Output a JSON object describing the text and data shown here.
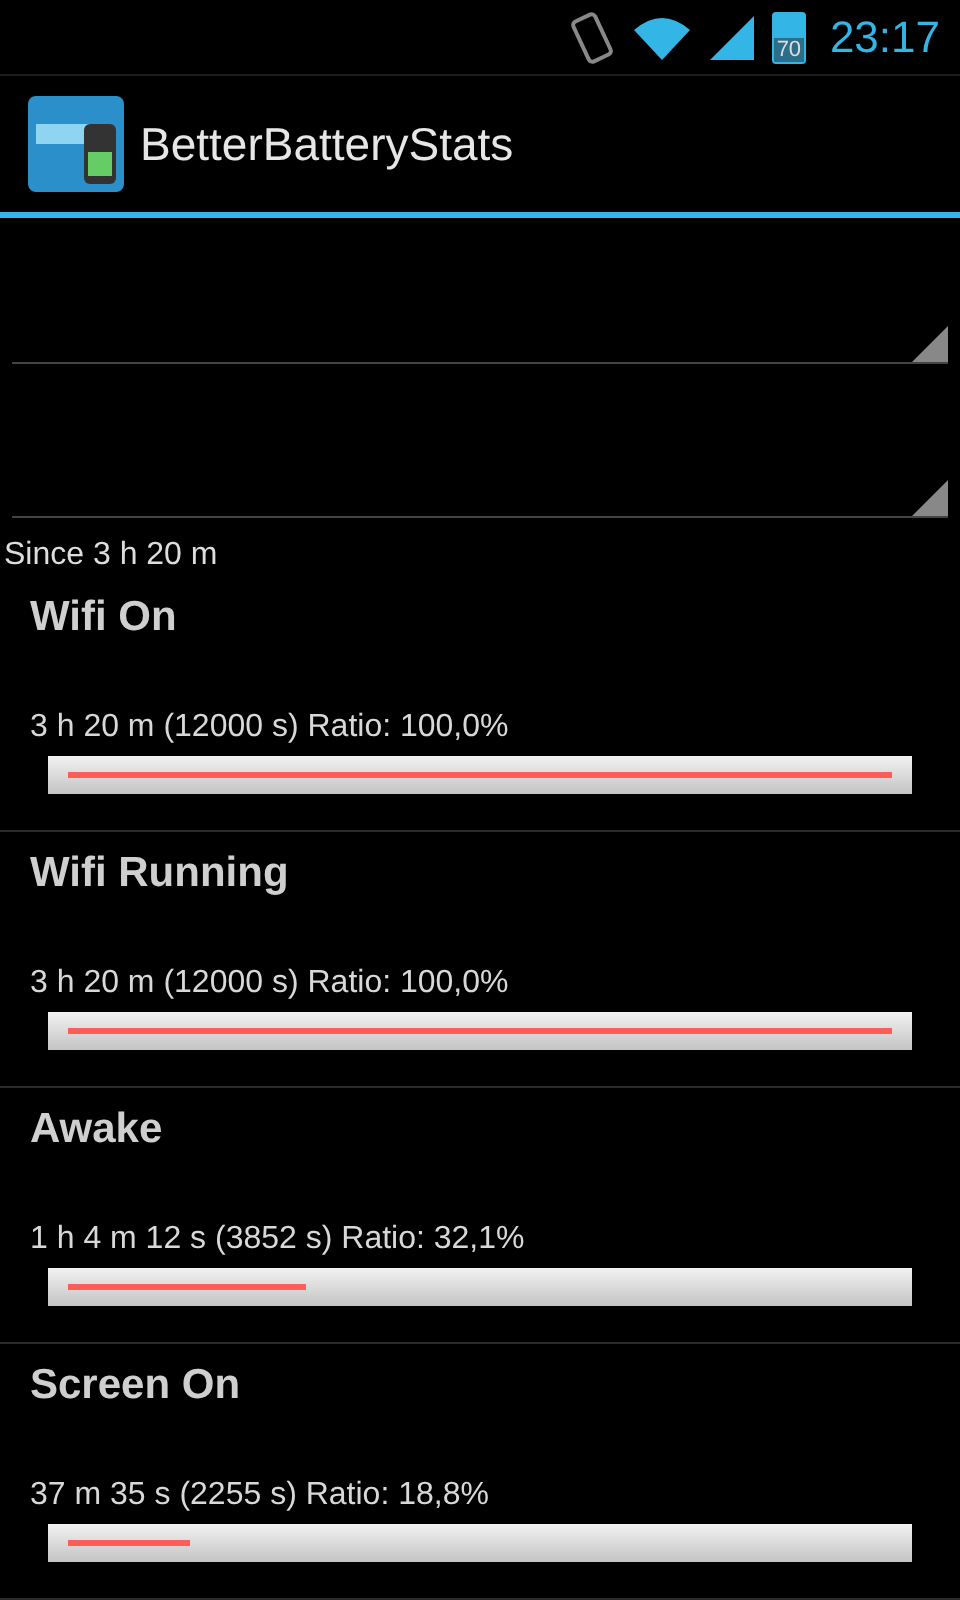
{
  "status_bar": {
    "battery": "70",
    "time": "23:17"
  },
  "action_bar": {
    "title": "BetterBatteryStats"
  },
  "spinners": [
    {
      "kind": "dropdown"
    },
    {
      "kind": "dropdown"
    }
  ],
  "since": "Since 3 h 20 m",
  "stats": [
    {
      "name": "Wifi On",
      "detail": "3 h 20 m  (12000 s) Ratio: 100,0%",
      "level": 1.0
    },
    {
      "name": "Wifi Running",
      "detail": "3 h 20 m  (12000 s) Ratio: 100,0%",
      "level": 1.0
    },
    {
      "name": "Awake",
      "detail": "1 h 4 m 12 s  (3852 s) Ratio: 32,1%",
      "level": 0.321
    },
    {
      "name": "Screen On",
      "detail": "37 m 35 s  (2255 s) Ratio: 18,8%",
      "level": 0.188
    }
  ]
}
